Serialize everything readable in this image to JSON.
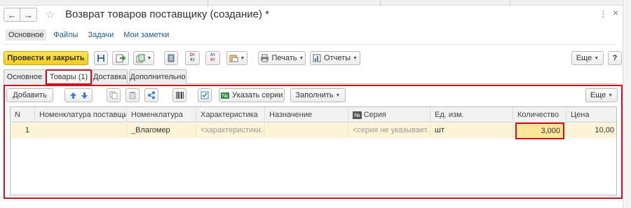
{
  "window": {
    "title": "Возврат товаров поставщику (создание) *",
    "more_glyph": "⋮",
    "close_glyph": "×",
    "favorite_glyph": "☆"
  },
  "nav": {
    "back_glyph": "←",
    "forward_glyph": "→"
  },
  "sections": [
    "Основное",
    "Файлы",
    "Задачи",
    "Мои заметки"
  ],
  "commands": {
    "post_close": "Провести и закрыть",
    "print": "Печать",
    "reports": "Отчеты",
    "more": "Еще",
    "help": "?",
    "dt_label": "Dт",
    "dt_sub": "Кт",
    "at_label": "Aт",
    "at_sub": "Кт"
  },
  "tabs": [
    "Основное",
    "Товары (1)",
    "Доставка",
    "Дополнительно"
  ],
  "table_toolbar": {
    "add": "Добавить",
    "specify_series": "Указать серии",
    "series_badge": "№",
    "fill": "Заполнить",
    "more": "Еще"
  },
  "table": {
    "columns": [
      "N",
      "Номенклатура поставщика",
      "Номенклатура",
      "Характеристика",
      "Назначение",
      "Серия",
      "Ед. изм.",
      "Количество",
      "Цена"
    ],
    "series_badge": "№",
    "rows": [
      {
        "n": "1",
        "supplier_item": "",
        "item": "_Влагомер",
        "characteristic": "<характеристики...",
        "purpose": "",
        "series": "<серия не указывает...",
        "unit": "шт",
        "quantity": "3,000",
        "price": "10,00"
      }
    ]
  },
  "colors": {
    "primary_button": "#f5cc1a",
    "highlight": "#d9101b",
    "row_bg": "#fbf4d6",
    "link": "#1c5a8e"
  }
}
